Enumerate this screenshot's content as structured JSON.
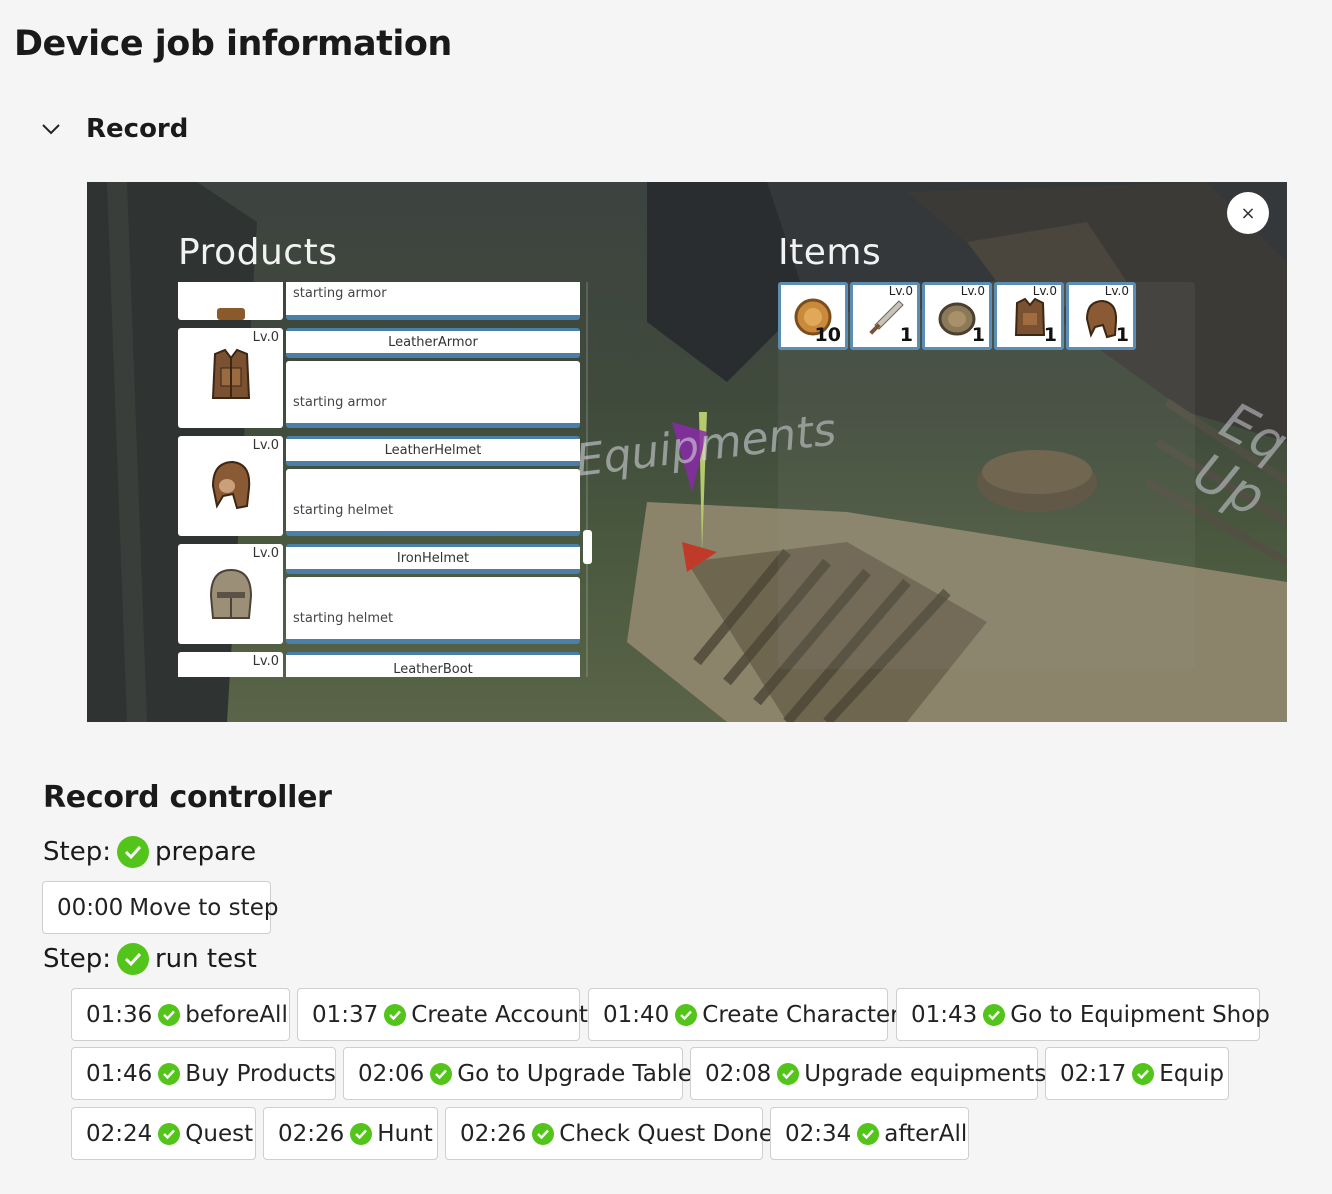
{
  "page": {
    "title": "Device job information"
  },
  "record": {
    "label": "Record"
  },
  "game": {
    "products_title": "Products",
    "items_title": "Items",
    "close_label": "×",
    "watermark": "Equipments",
    "watermark_side": "Eq\nUp",
    "products": [
      {
        "lv": "",
        "name": "",
        "desc": "starting armor"
      },
      {
        "lv": "Lv.0",
        "name": "LeatherArmor",
        "desc": "starting armor"
      },
      {
        "lv": "Lv.0",
        "name": "LeatherHelmet",
        "desc": "starting helmet"
      },
      {
        "lv": "Lv.0",
        "name": "IronHelmet",
        "desc": "starting helmet"
      },
      {
        "lv": "Lv.0",
        "name": "LeatherBoot",
        "desc": ""
      }
    ],
    "items": [
      {
        "lv": "",
        "qty": "10",
        "icon": "coin-icon"
      },
      {
        "lv": "Lv.0",
        "qty": "1",
        "icon": "sword-icon"
      },
      {
        "lv": "Lv.0",
        "qty": "1",
        "icon": "shield-icon"
      },
      {
        "lv": "Lv.0",
        "qty": "1",
        "icon": "armor-icon"
      },
      {
        "lv": "Lv.0",
        "qty": "1",
        "icon": "helmet-icon"
      }
    ]
  },
  "controller": {
    "title": "Record controller",
    "step_label": "Step:",
    "steps": [
      {
        "name": "prepare",
        "buttons": [
          {
            "time": "00:00",
            "label": "Move to step",
            "check": false
          }
        ]
      },
      {
        "name": "run test",
        "buttons": [
          {
            "time": "01:36",
            "label": "beforeAll"
          },
          {
            "time": "01:37",
            "label": "Create Account"
          },
          {
            "time": "01:40",
            "label": "Create Character"
          },
          {
            "time": "01:43",
            "label": "Go to Equipment Shop"
          },
          {
            "time": "01:46",
            "label": "Buy Products"
          },
          {
            "time": "02:06",
            "label": "Go to Upgrade Table"
          },
          {
            "time": "02:08",
            "label": "Upgrade equipments"
          },
          {
            "time": "02:17",
            "label": "Equip"
          },
          {
            "time": "02:24",
            "label": "Quest"
          },
          {
            "time": "02:26",
            "label": "Hunt"
          },
          {
            "time": "02:26",
            "label": "Check Quest Done"
          },
          {
            "time": "02:34",
            "label": "afterAll"
          }
        ]
      }
    ]
  },
  "colors": {
    "success": "#52c41a",
    "panel_border": "#4a7fa8"
  }
}
